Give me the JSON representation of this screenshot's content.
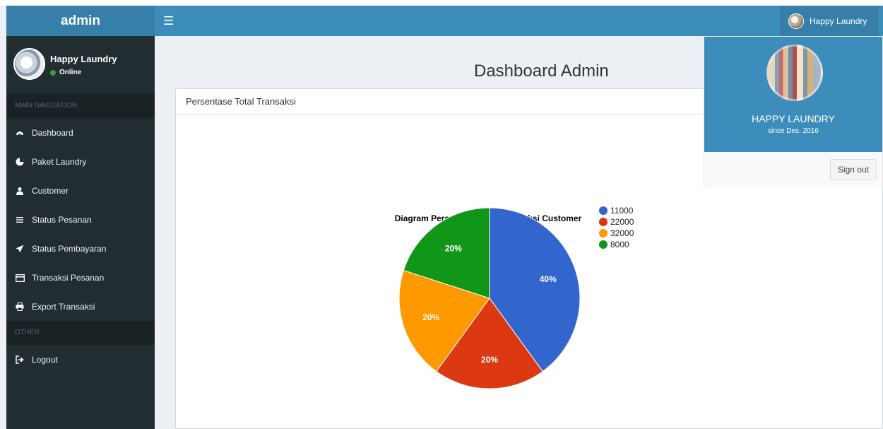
{
  "app": {
    "title": "admin",
    "menu_icon": "bars-icon"
  },
  "user": {
    "name": "Happy Laundry",
    "status": "Online"
  },
  "sidebar": {
    "main_header": "MAIN NAVIGATION",
    "items": [
      {
        "label": "Dashboard",
        "icon": "dashboard-icon"
      },
      {
        "label": "Paket Laundry",
        "icon": "pie-chart-icon"
      },
      {
        "label": "Customer",
        "icon": "user-icon"
      },
      {
        "label": "Status Pesanan",
        "icon": "list-icon"
      },
      {
        "label": "Status Pembayaran",
        "icon": "send-icon"
      },
      {
        "label": "Transaksi Pesanan",
        "icon": "credit-card-icon"
      },
      {
        "label": "Export Transaksi",
        "icon": "print-icon"
      }
    ],
    "other_header": "OTHER",
    "other_items": [
      {
        "label": "Logout",
        "icon": "sign-out-icon"
      }
    ]
  },
  "page": {
    "title": "Dashboard Admin"
  },
  "box": {
    "title": "Persentase Total Transaksi"
  },
  "dropdown": {
    "name": "HAPPY LAUNDRY",
    "since": "since Des. 2016",
    "signout_label": "Sign out"
  },
  "colors": {
    "navbar": "#3c8dbc",
    "sidebar": "#222d32",
    "accent": "#367fa9"
  },
  "chart_data": {
    "type": "pie",
    "title": "Diagram Persentase Total Transaksi Customer",
    "legend_position": "right",
    "slices": [
      {
        "label": "11000",
        "value": 40,
        "display": "40%",
        "color": "#3366cc"
      },
      {
        "label": "22000",
        "value": 20,
        "display": "20%",
        "color": "#dc3912"
      },
      {
        "label": "32000",
        "value": 20,
        "display": "20%",
        "color": "#ff9900"
      },
      {
        "label": "8000",
        "value": 20,
        "display": "20%",
        "color": "#109618"
      }
    ]
  }
}
